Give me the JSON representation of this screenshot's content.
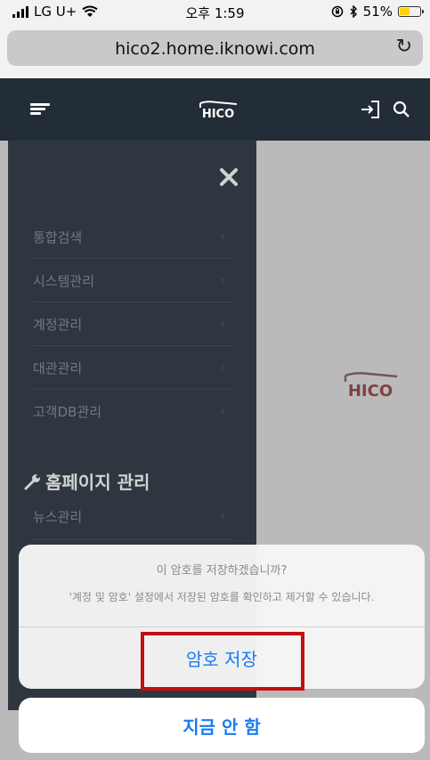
{
  "status_bar": {
    "carrier": "LG U+",
    "time": "오후 1:59",
    "battery": "51%",
    "battery_level": 0.51,
    "battery_color": "#ffd400"
  },
  "browser": {
    "url": "hico2.home.iknowi.com",
    "reload_icon": "reload-icon"
  },
  "header": {
    "logo": "HICO",
    "menu_icon": "hamburger-menu-icon",
    "login_icon": "login-icon",
    "search_icon": "search-icon",
    "background": "#222d37"
  },
  "content": {
    "logo": "HICO"
  },
  "sidebar": {
    "background": "#39444f",
    "close_icon": "close-icon",
    "items": [
      {
        "label": "통합검색"
      },
      {
        "label": "시스템관리"
      },
      {
        "label": "계정관리"
      },
      {
        "label": "대관관리"
      },
      {
        "label": "고객DB관리"
      }
    ],
    "section": {
      "icon": "wrench-icon",
      "title": "홈페이지 관리"
    },
    "section_items": [
      {
        "label": "뉴스관리"
      }
    ]
  },
  "dialog": {
    "title": "이 암호를 저장하겠습니까?",
    "message": "'계정 및 암호' 설정에서 저장된 암호를 확인하고 제거할 수 있습니다.",
    "save_label": "암호 저장",
    "cancel_label": "지금 안 함",
    "accent_color": "#1a7cf2",
    "highlight_color": "#c40f10"
  }
}
